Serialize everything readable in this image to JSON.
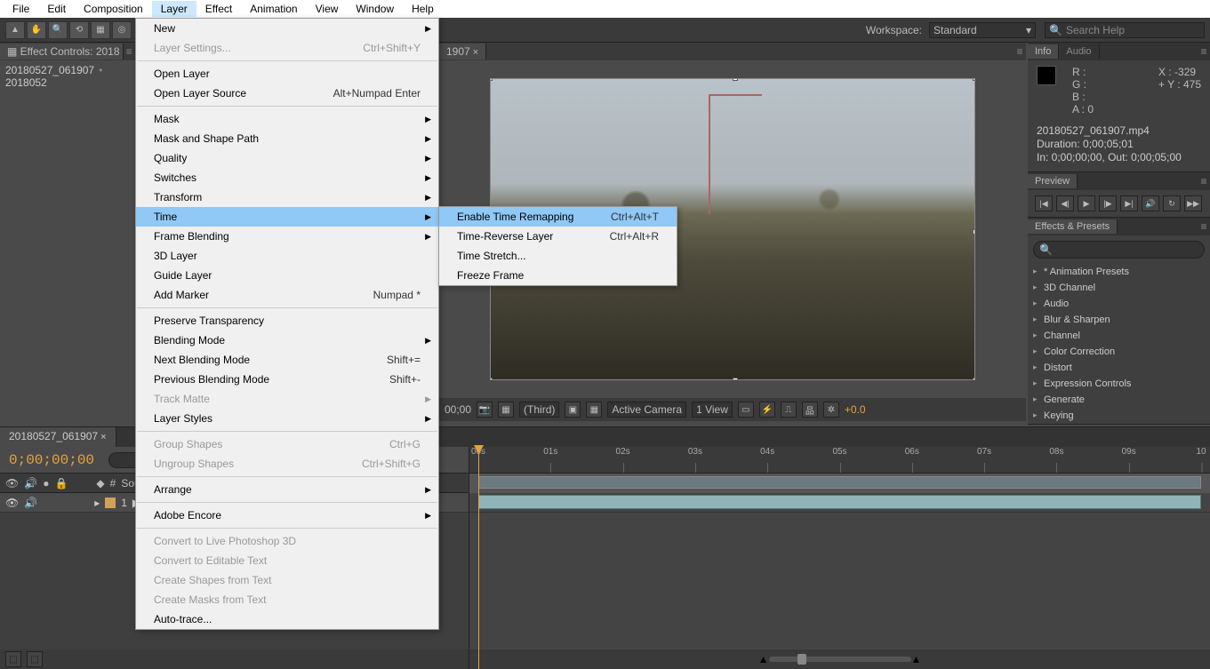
{
  "menubar": [
    "File",
    "Edit",
    "Composition",
    "Layer",
    "Effect",
    "Animation",
    "View",
    "Window",
    "Help"
  ],
  "menubar_active_index": 3,
  "workspace": {
    "label": "Workspace:",
    "value": "Standard"
  },
  "search_help_placeholder": "Search Help",
  "left_panel": {
    "tab": "Effect Controls: 2018",
    "breadcrumb_a": "20180527_061907",
    "breadcrumb_b": "2018052"
  },
  "layer_menu": [
    {
      "label": "New",
      "arrow": true
    },
    {
      "label": "Layer Settings...",
      "shortcut": "Ctrl+Shift+Y",
      "disabled": true
    },
    "sep",
    {
      "label": "Open Layer"
    },
    {
      "label": "Open Layer Source",
      "shortcut": "Alt+Numpad Enter"
    },
    "sep",
    {
      "label": "Mask",
      "arrow": true
    },
    {
      "label": "Mask and Shape Path",
      "arrow": true
    },
    {
      "label": "Quality",
      "arrow": true
    },
    {
      "label": "Switches",
      "arrow": true
    },
    {
      "label": "Transform",
      "arrow": true
    },
    {
      "label": "Time",
      "arrow": true,
      "hl": true
    },
    {
      "label": "Frame Blending",
      "arrow": true
    },
    {
      "label": "3D Layer"
    },
    {
      "label": "Guide Layer"
    },
    {
      "label": "Add Marker",
      "shortcut": "Numpad *"
    },
    "sep",
    {
      "label": "Preserve Transparency"
    },
    {
      "label": "Blending Mode",
      "arrow": true
    },
    {
      "label": "Next Blending Mode",
      "shortcut": "Shift+="
    },
    {
      "label": "Previous Blending Mode",
      "shortcut": "Shift+-"
    },
    {
      "label": "Track Matte",
      "arrow": true,
      "disabled": true
    },
    {
      "label": "Layer Styles",
      "arrow": true
    },
    "sep",
    {
      "label": "Group Shapes",
      "shortcut": "Ctrl+G",
      "disabled": true
    },
    {
      "label": "Ungroup Shapes",
      "shortcut": "Ctrl+Shift+G",
      "disabled": true
    },
    "sep",
    {
      "label": "Arrange",
      "arrow": true
    },
    "sep",
    {
      "label": "Adobe Encore",
      "arrow": true
    },
    "sep",
    {
      "label": "Convert to Live Photoshop 3D",
      "disabled": true
    },
    {
      "label": "Convert to Editable Text",
      "disabled": true
    },
    {
      "label": "Create Shapes from Text",
      "disabled": true
    },
    {
      "label": "Create Masks from Text",
      "disabled": true
    },
    {
      "label": "Auto-trace..."
    }
  ],
  "time_submenu": [
    {
      "label": "Enable Time Remapping",
      "shortcut": "Ctrl+Alt+T",
      "hl": true
    },
    {
      "label": "Time-Reverse Layer",
      "shortcut": "Ctrl+Alt+R"
    },
    {
      "label": "Time Stretch..."
    },
    {
      "label": "Freeze Frame"
    }
  ],
  "center": {
    "tab": "1907",
    "footer_time": "00;00",
    "quality": "(Third)",
    "camera": "Active Camera",
    "views": "1 View",
    "exposure": "+0.0"
  },
  "info": {
    "tab_info": "Info",
    "tab_audio": "Audio",
    "r": "R :",
    "g": "G :",
    "b": "B :",
    "a": "A :",
    "a_val": "0",
    "x": "X :",
    "x_val": "-329",
    "y": "Y :",
    "y_val": "475",
    "file": "20180527_061907.mp4",
    "duration": "Duration: 0;00;05;01",
    "inout": "In: 0;00;00;00, Out: 0;00;05;00"
  },
  "preview": {
    "tab": "Preview"
  },
  "effects_presets": {
    "tab": "Effects & Presets",
    "items": [
      "* Animation Presets",
      "3D Channel",
      "Audio",
      "Blur & Sharpen",
      "Channel",
      "Color Correction",
      "Distort",
      "Expression Controls",
      "Generate",
      "Keying"
    ]
  },
  "timeline": {
    "tab": "20180527_061907",
    "timecode": "0;00;00;00",
    "col_num": "#",
    "col_source": "Source Name",
    "layer_num": "1",
    "ticks": [
      "00s",
      "01s",
      "02s",
      "03s",
      "04s",
      "05s",
      "06s",
      "07s",
      "08s",
      "09s",
      "10"
    ]
  }
}
